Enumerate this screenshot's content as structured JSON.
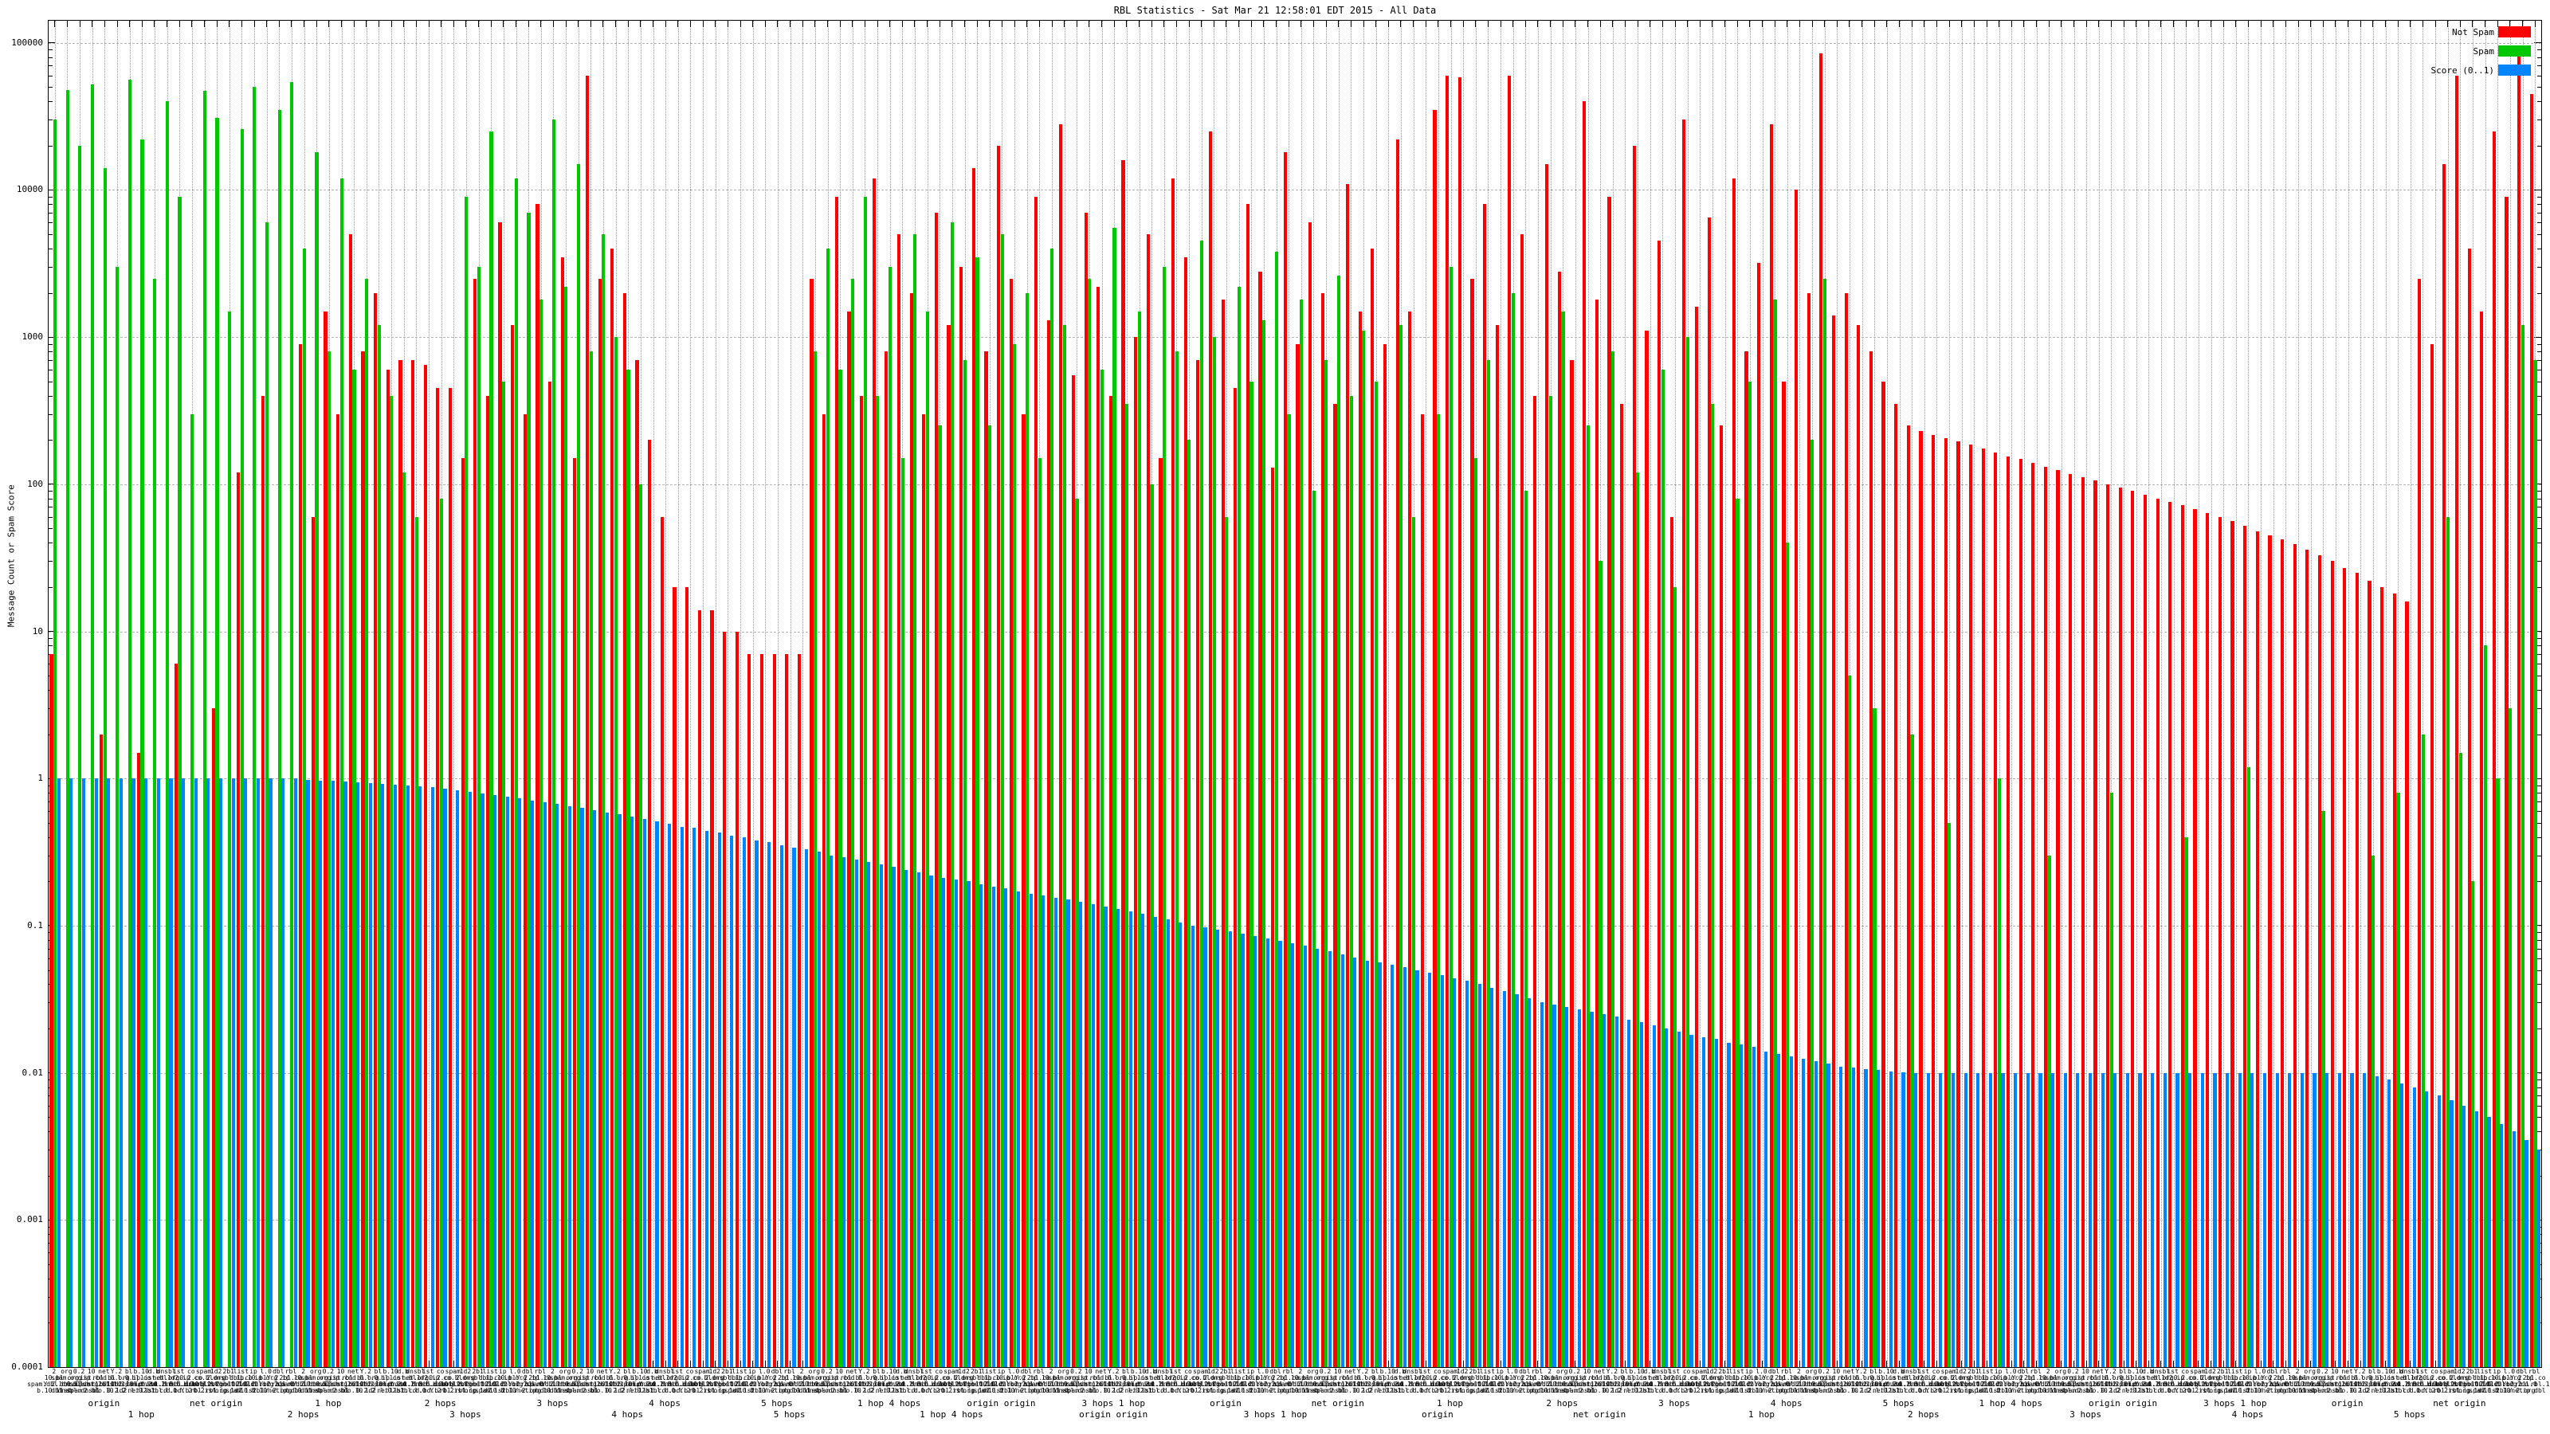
{
  "title": "RBL Statistics - Sat Mar 21 12:58:01 EDT 2015 - All Data",
  "y_axis": {
    "label": "Message Count or Spam Score",
    "scale": "log",
    "min": 0.0001,
    "max": 100000,
    "tick_labels": [
      "100000",
      "10000",
      "1000",
      "100",
      "10",
      "1",
      "0.1",
      "0.01",
      "0.001",
      "0.0001"
    ]
  },
  "x_axis": {
    "labels_illegible": true,
    "readable_sublabels": [
      "origin",
      "net origin",
      "1 hop",
      "2 hops",
      "3 hops",
      "4 hops",
      "5 hops",
      "1 hop 4 hops",
      "origin origin",
      "3 hops 1 hop"
    ],
    "illegible_fragments": [
      "2",
      "10",
      "bl",
      "dnsbl",
      "spam",
      "list",
      "dbl",
      "org",
      "net",
      "b.10",
      "ist",
      "1d2",
      "ip",
      "rbl",
      "0.2",
      "Y.2",
      "d.b",
      "co",
      "2b1",
      "l.0"
    ]
  },
  "legend": {
    "position": "top-right",
    "entries": [
      {
        "label": "Not Spam",
        "color": "#ff0000"
      },
      {
        "label": "Spam",
        "color": "#00c800"
      },
      {
        "label": "Score (0..1)",
        "color": "#0084ff"
      }
    ]
  },
  "chart_data": {
    "type": "bar",
    "title": "RBL Statistics - Sat Mar 21 12:58:01 EDT 2015 - All Data",
    "xlabel": "",
    "ylabel": "Message Count or Spam Score",
    "yscale": "log",
    "ylim": [
      0.0001,
      100000
    ],
    "grid": true,
    "legend_position": "top-right",
    "n_categories": 200,
    "categories_note": "~470 RBL host labels, overlapping and illegible in source image; readable second-line qualifiers: origin / net origin / 1-5 hops",
    "series": [
      {
        "name": "Not Spam",
        "color": "#ff0000",
        "values": [
          7,
          0,
          0,
          0,
          2,
          0,
          0,
          1.5,
          0,
          0,
          6,
          0,
          0,
          3,
          0,
          120,
          0,
          400,
          0,
          0,
          900,
          60,
          1500,
          300,
          5000,
          800,
          2000,
          600,
          700,
          700,
          650,
          450,
          450,
          150,
          2500,
          400,
          6000,
          1200,
          300,
          8000,
          500,
          3500,
          150,
          60000,
          2500,
          4000,
          2000,
          700,
          200,
          60,
          20,
          20,
          14,
          14,
          10,
          10,
          7,
          7,
          7,
          7,
          7,
          2500,
          300,
          9000,
          1500,
          400,
          12000,
          800,
          5000,
          2000,
          300,
          7000,
          1200,
          3000,
          14000,
          800,
          20000,
          2500,
          300,
          9000,
          1300,
          28000,
          550,
          7000,
          2200,
          400,
          16000,
          1000,
          5000,
          150,
          12000,
          3500,
          700,
          25000,
          1800,
          450,
          8000,
          2800,
          130,
          18000,
          900,
          6000,
          2000,
          350,
          11000,
          1500,
          4000,
          900,
          22000,
          1500,
          300,
          35000,
          60000,
          58000,
          2500,
          8000,
          1200,
          60000,
          5000,
          400,
          15000,
          2800,
          700,
          40000,
          1800,
          9000,
          350,
          20000,
          1100,
          4500,
          60,
          30000,
          1600,
          6500,
          250,
          12000,
          800,
          3200,
          28000,
          500,
          10000,
          2000,
          85000,
          1400,
          2000,
          1200,
          800,
          500,
          350,
          250,
          230,
          215,
          205,
          195,
          185,
          175,
          165,
          155,
          148,
          140,
          132,
          125,
          118,
          112,
          106,
          100,
          95,
          90,
          85,
          80,
          76,
          72,
          68,
          64,
          60,
          56,
          52,
          48,
          45,
          42,
          39,
          36,
          33,
          30,
          27,
          25,
          22,
          20,
          18,
          16,
          2500,
          900,
          15000,
          60000,
          4000,
          1500,
          25000,
          9000,
          85000,
          45000
        ]
      },
      {
        "name": "Spam",
        "color": "#00c800",
        "values": [
          30000,
          48000,
          20000,
          52000,
          14000,
          3000,
          56000,
          22000,
          2500,
          40000,
          9000,
          300,
          47000,
          31000,
          1500,
          26000,
          50000,
          6000,
          35000,
          54000,
          4000,
          18000,
          800,
          12000,
          600,
          2500,
          1200,
          400,
          120,
          60,
          0,
          80,
          0,
          9000,
          3000,
          25000,
          500,
          12000,
          7000,
          1800,
          30000,
          2200,
          15000,
          800,
          5000,
          1000,
          600,
          100,
          0,
          0,
          0,
          0,
          0,
          0,
          0,
          0,
          0,
          0,
          0,
          0,
          0,
          800,
          4000,
          600,
          2500,
          9000,
          400,
          3000,
          150,
          5000,
          1500,
          250,
          6000,
          700,
          3500,
          250,
          5000,
          900,
          2000,
          150,
          4000,
          1200,
          80,
          2500,
          600,
          5500,
          350,
          1500,
          100,
          3000,
          800,
          200,
          4500,
          1000,
          60,
          2200,
          500,
          1300,
          3800,
          300,
          1800,
          90,
          700,
          2600,
          400,
          1100,
          500,
          0,
          1200,
          60,
          0,
          300,
          3000,
          0,
          150,
          700,
          0,
          2000,
          90,
          0,
          400,
          1500,
          0,
          250,
          30,
          800,
          0,
          120,
          0,
          600,
          20,
          1000,
          0,
          350,
          0,
          80,
          500,
          0,
          1800,
          40,
          0,
          200,
          2500,
          0,
          5,
          0,
          3,
          0,
          0,
          2,
          0,
          0,
          0.5,
          0,
          0,
          0,
          1,
          0,
          0,
          0,
          0.3,
          0,
          0,
          0,
          0,
          0.8,
          0,
          0,
          0,
          0,
          0,
          0.4,
          0,
          0,
          0,
          0,
          1.2,
          0,
          0,
          0,
          0,
          0,
          0.6,
          0,
          0,
          0,
          0.3,
          0,
          0.8,
          0,
          2,
          0,
          60,
          1.5,
          0.2,
          8,
          1,
          3,
          1200,
          700
        ]
      },
      {
        "name": "Score (0..1)",
        "color": "#0084ff",
        "values": [
          1,
          1,
          1,
          1,
          1,
          1,
          1,
          1,
          1,
          1,
          1,
          1,
          1,
          1,
          1,
          1,
          1,
          1,
          1,
          1,
          0.98,
          0.97,
          0.96,
          0.95,
          0.94,
          0.93,
          0.92,
          0.91,
          0.9,
          0.89,
          0.87,
          0.85,
          0.83,
          0.81,
          0.79,
          0.77,
          0.75,
          0.73,
          0.71,
          0.69,
          0.67,
          0.65,
          0.63,
          0.61,
          0.59,
          0.57,
          0.55,
          0.53,
          0.51,
          0.49,
          0.47,
          0.46,
          0.44,
          0.43,
          0.41,
          0.4,
          0.38,
          0.37,
          0.35,
          0.34,
          0.33,
          0.32,
          0.3,
          0.29,
          0.28,
          0.27,
          0.26,
          0.25,
          0.24,
          0.23,
          0.22,
          0.21,
          0.205,
          0.2,
          0.19,
          0.185,
          0.18,
          0.17,
          0.165,
          0.16,
          0.155,
          0.15,
          0.145,
          0.14,
          0.135,
          0.13,
          0.125,
          0.12,
          0.115,
          0.11,
          0.105,
          0.1,
          0.097,
          0.094,
          0.091,
          0.088,
          0.085,
          0.082,
          0.079,
          0.076,
          0.073,
          0.07,
          0.067,
          0.064,
          0.061,
          0.058,
          0.056,
          0.054,
          0.052,
          0.05,
          0.048,
          0.046,
          0.044,
          0.042,
          0.04,
          0.038,
          0.036,
          0.034,
          0.032,
          0.03,
          0.029,
          0.028,
          0.027,
          0.026,
          0.025,
          0.024,
          0.023,
          0.022,
          0.021,
          0.02,
          0.019,
          0.018,
          0.0175,
          0.017,
          0.016,
          0.0155,
          0.015,
          0.014,
          0.0135,
          0.013,
          0.0125,
          0.012,
          0.0115,
          0.011,
          0.0108,
          0.0106,
          0.0104,
          0.0102,
          0.0101,
          0.01,
          0.01,
          0.01,
          0.01,
          0.01,
          0.01,
          0.01,
          0.01,
          0.01,
          0.01,
          0.01,
          0.01,
          0.01,
          0.01,
          0.01,
          0.01,
          0.01,
          0.01,
          0.01,
          0.01,
          0.01,
          0.01,
          0.01,
          0.01,
          0.01,
          0.01,
          0.01,
          0.01,
          0.01,
          0.01,
          0.01,
          0.01,
          0.01,
          0.01,
          0.01,
          0.01,
          0.01,
          0.0095,
          0.009,
          0.0085,
          0.008,
          0.0075,
          0.007,
          0.0065,
          0.006,
          0.0055,
          0.005,
          0.0045,
          0.004,
          0.0035,
          0.003
        ]
      }
    ]
  }
}
